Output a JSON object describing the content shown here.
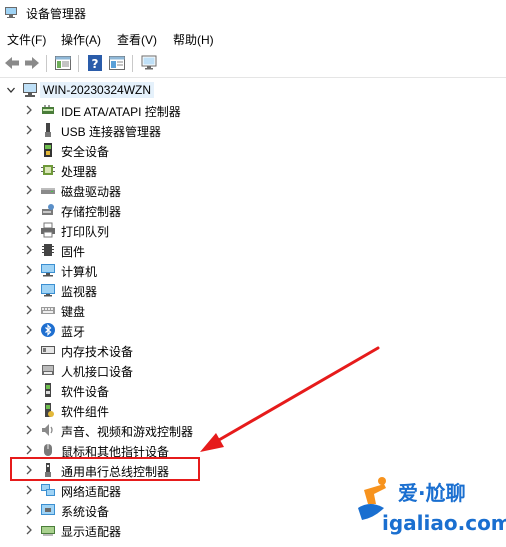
{
  "window": {
    "title": "设备管理器"
  },
  "menu": [
    "文件(F)",
    "操作(A)",
    "查看(V)",
    "帮助(H)"
  ],
  "tree": {
    "root": "WIN-20230324WZN",
    "items": [
      {
        "label": "IDE ATA/ATAPI 控制器",
        "icon": "ide-controller-icon"
      },
      {
        "label": "USB 连接器管理器",
        "icon": "usb-connector-icon"
      },
      {
        "label": "安全设备",
        "icon": "security-device-icon"
      },
      {
        "label": "处理器",
        "icon": "processor-icon"
      },
      {
        "label": "磁盘驱动器",
        "icon": "disk-drive-icon"
      },
      {
        "label": "存储控制器",
        "icon": "storage-controller-icon"
      },
      {
        "label": "打印队列",
        "icon": "printer-icon"
      },
      {
        "label": "固件",
        "icon": "firmware-icon"
      },
      {
        "label": "计算机",
        "icon": "computer-icon"
      },
      {
        "label": "监视器",
        "icon": "monitor-icon"
      },
      {
        "label": "键盘",
        "icon": "keyboard-icon"
      },
      {
        "label": "蓝牙",
        "icon": "bluetooth-icon"
      },
      {
        "label": "内存技术设备",
        "icon": "memory-technology-icon"
      },
      {
        "label": "人机接口设备",
        "icon": "hid-icon"
      },
      {
        "label": "软件设备",
        "icon": "software-device-icon"
      },
      {
        "label": "软件组件",
        "icon": "software-component-icon"
      },
      {
        "label": "声音、视频和游戏控制器",
        "icon": "sound-icon"
      },
      {
        "label": "鼠标和其他指针设备",
        "icon": "mouse-icon"
      },
      {
        "label": "通用串行总线控制器",
        "icon": "usb-controller-icon"
      },
      {
        "label": "网络适配器",
        "icon": "network-adapter-icon"
      },
      {
        "label": "系统设备",
        "icon": "system-device-icon"
      },
      {
        "label": "显示适配器",
        "icon": "display-adapter-icon"
      }
    ]
  },
  "watermark": {
    "line1": "爱·尬聊",
    "line2": "igaliao.com"
  },
  "colors": {
    "highlight": "#e61b1b",
    "selection": "#e5f1fb",
    "watermark_blue": "#1a6fd0",
    "watermark_orange": "#f7931e"
  }
}
